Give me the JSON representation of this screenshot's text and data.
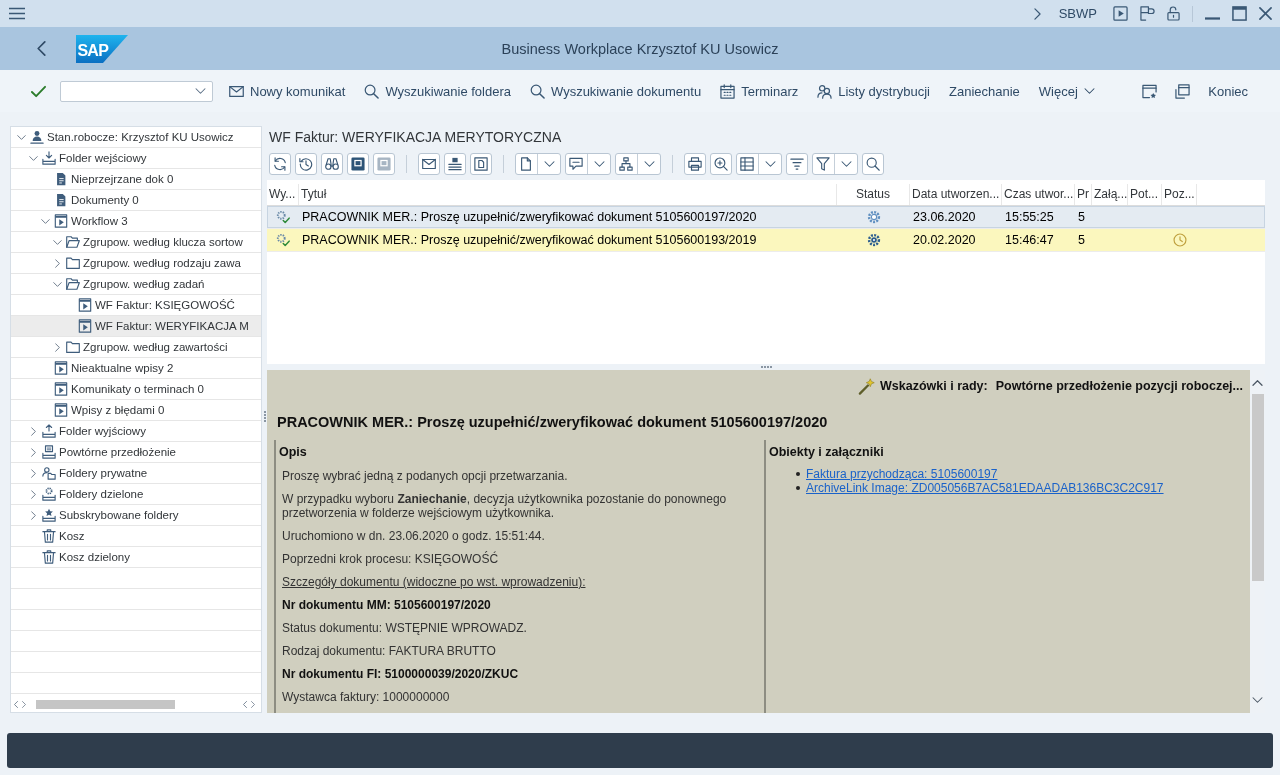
{
  "top_bar": {
    "transaction": "SBWP"
  },
  "title_bar": {
    "logo": "SAP",
    "title": "Business Workplace Krzysztof KU Usowicz"
  },
  "toolbar": {
    "buttons": [
      {
        "kind": "envelope",
        "label": "Nowy komunikat"
      },
      {
        "kind": "search",
        "label": "Wyszukiwanie foldera"
      },
      {
        "kind": "search",
        "label": "Wyszukiwanie dokumentu"
      },
      {
        "kind": "calendar",
        "label": "Terminarz"
      },
      {
        "kind": "people",
        "label": "Listy dystrybucji"
      },
      {
        "kind": "plain",
        "label": "Zaniechanie"
      },
      {
        "kind": "menu",
        "label": "Więcej"
      }
    ],
    "end_buttons": [
      {
        "kind": "window-star"
      },
      {
        "kind": "windows"
      },
      {
        "kind": "plain",
        "label": "Koniec"
      }
    ]
  },
  "tree": {
    "items": [
      {
        "label": "Stan.robocze: Krzysztof KU Usowicz",
        "kind": "user",
        "expanded": true,
        "selected": false,
        "children": [
          {
            "label": "Folder wejściowy",
            "kind": "inbox",
            "expanded": true,
            "selected": false,
            "children": [
              {
                "label": "Nieprzejrzane dok 0",
                "kind": "document",
                "selected": false
              },
              {
                "label": "Dokumenty 0",
                "kind": "document",
                "selected": false
              },
              {
                "label": "Workflow 3",
                "kind": "workflow",
                "expanded": true,
                "selected": false,
                "children": [
                  {
                    "label": "Zgrupow. według klucza sortow",
                    "kind": "folder",
                    "expanded": true,
                    "selected": false
                  },
                  {
                    "label": "Zgrupow. według rodzaju zawa",
                    "kind": "folder",
                    "expanded": false,
                    "selected": false
                  },
                  {
                    "label": "Zgrupow. według zadań",
                    "kind": "folder",
                    "expanded": true,
                    "selected": false,
                    "children": [
                      {
                        "label": "WF Faktur: KSIĘGOWOŚĆ",
                        "kind": "workflow",
                        "selected": false
                      },
                      {
                        "label": "WF Faktur: WERYFIKACJA M",
                        "kind": "workflow",
                        "selected": true
                      }
                    ]
                  },
                  {
                    "label": "Zgrupow. według zawartości",
                    "kind": "folder",
                    "expanded": false,
                    "selected": false
                  }
                ]
              },
              {
                "label": "Nieaktualne wpisy 2",
                "kind": "workflow",
                "selected": false
              },
              {
                "label": "Komunikaty o terminach 0",
                "kind": "workflow",
                "selected": false
              },
              {
                "label": "Wpisy z błędami 0",
                "kind": "workflow",
                "selected": false
              }
            ]
          },
          {
            "label": "Folder wyjściowy",
            "kind": "outbox",
            "expanded": false,
            "selected": false
          },
          {
            "label": "Powtórne przedłożenie",
            "kind": "resubmission",
            "expanded": false,
            "selected": false
          },
          {
            "label": "Foldery prywatne",
            "kind": "private",
            "expanded": false,
            "selected": false
          },
          {
            "label": "Foldery dzielone",
            "kind": "shared",
            "expanded": false,
            "selected": false
          },
          {
            "label": "Subskrybowane foldery",
            "kind": "subscribed",
            "expanded": false,
            "selected": false
          },
          {
            "label": "Kosz",
            "kind": "trash",
            "selected": false
          },
          {
            "label": "Kosz dzielony",
            "kind": "trash",
            "selected": false
          }
        ]
      }
    ]
  },
  "folder_view": {
    "title": "WF Faktur: WERYFIKACJA MERYTORYCZNA",
    "toolbar": [
      [
        {
          "kind": "refresh",
          "menu": false
        },
        {
          "kind": "history",
          "menu": false
        },
        {
          "kind": "binoculars",
          "menu": false
        },
        {
          "kind": "tile-filled",
          "menu": false
        },
        {
          "kind": "tile-faded",
          "menu": false
        }
      ],
      [
        {
          "kind": "envelope",
          "menu": false
        },
        {
          "kind": "tray-stack",
          "menu": false
        },
        {
          "kind": "framed-page",
          "menu": false
        }
      ],
      [
        {
          "kind": "page",
          "menu": true
        },
        {
          "kind": "comment",
          "menu": true
        },
        {
          "kind": "hierarchy",
          "menu": true
        }
      ],
      [
        {
          "kind": "printer",
          "menu": false
        },
        {
          "kind": "zoom",
          "menu": false
        },
        {
          "kind": "grid",
          "menu": true
        },
        {
          "kind": "lines",
          "menu": false
        },
        {
          "kind": "filter",
          "menu": true
        },
        {
          "kind": "search",
          "menu": false
        }
      ]
    ],
    "table": {
      "columns": [
        {
          "label": "Wy..."
        },
        {
          "label": "Tytuł"
        },
        {
          "label": "Status"
        },
        {
          "label": "Data utworzen..."
        },
        {
          "label": "Czas utwor..."
        },
        {
          "label": "Pr"
        },
        {
          "label": "Załą..."
        },
        {
          "label": "Pot..."
        },
        {
          "label": "Poz..."
        }
      ],
      "rows": [
        {
          "title": "PRACOWNIK MER.: Proszę uzupełnić/zweryfikować dokument 5105600197/2020",
          "status": {
            "kind": "outline"
          },
          "date": "23.06.2020",
          "time": "15:55:25",
          "priority": "5",
          "deadline": false,
          "selected": true,
          "highlighted": false
        },
        {
          "title": "PRACOWNIK MER.: Proszę uzupełnić/zweryfikować dokument 5105600193/2019",
          "status": {
            "kind": "solid"
          },
          "date": "20.02.2020",
          "time": "15:46:47",
          "priority": "5",
          "deadline": true,
          "selected": false,
          "highlighted": true
        }
      ]
    }
  },
  "detail": {
    "tips_label": "Wskazówki i rady:",
    "tips_text": "Powtórne przedłożenie pozycji roboczej...",
    "heading": "PRACOWNIK MER.: Proszę uzupełnić/zweryfikować dokument 5105600197/2020",
    "description": {
      "title": "Opis",
      "paragraphs": [
        {
          "kind": "plain",
          "text": "Proszę wybrać jedną z podanych opcji przetwarzania."
        },
        {
          "kind": "plain",
          "text": "W przypadku wyboru **Zaniechanie**, decyzja użytkownika pozostanie do ponownego przetworzenia w folderze wejściowym użytkownika."
        },
        {
          "kind": "plain",
          "text": "Uruchomiono w dn. 23.06.2020 o godz. 15:51:44."
        },
        {
          "kind": "plain",
          "text": "Poprzedni krok procesu: KSIĘGOWOŚĆ"
        },
        {
          "kind": "underlined",
          "text": "Szczegóły dokumentu (widoczne po wst. wprowadzeniu):"
        },
        {
          "kind": "bold",
          "text": "Nr dokumentu MM: 5105600197/2020"
        },
        {
          "kind": "plain",
          "text": "Status dokumentu: WSTĘPNIE WPROWADZ."
        },
        {
          "kind": "plain",
          "text": "Rodzaj dokumentu: FAKTURA BRUTTO"
        },
        {
          "kind": "bold",
          "text": "Nr dokumentu FI: 5100000039/2020/ZKUC"
        },
        {
          "kind": "plain",
          "text": "Wystawca faktury: 1000000000"
        }
      ]
    },
    "attachments": {
      "title": "Obiekty i załączniki",
      "links": [
        "Faktura przychodząca: 5105600197",
        "ArchiveLink Image: ZD005056B7AC581EDAADAB136BC3C2C917"
      ]
    }
  }
}
